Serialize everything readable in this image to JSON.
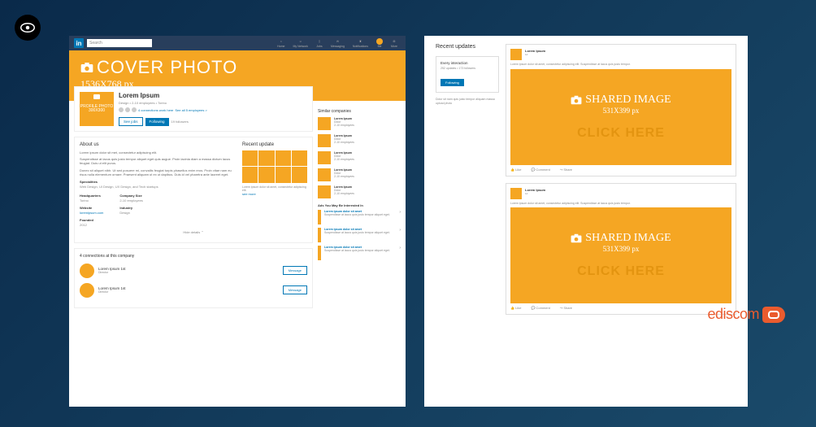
{
  "header": {
    "search_placeholder": "Search",
    "nav": [
      {
        "label": "Home"
      },
      {
        "label": "My Network"
      },
      {
        "label": "Jobs"
      },
      {
        "label": "Messaging"
      },
      {
        "label": "Notifications"
      },
      {
        "label": "Me"
      },
      {
        "label": "More"
      }
    ]
  },
  "cover": {
    "title": "COVER PHOTO",
    "size": "1536X768 px"
  },
  "profile": {
    "photo_label": "PROFILE PHOTO 300X300",
    "name": "Lorem Ipsum",
    "tagline": "Design • 2-10 employees • Torino",
    "connections_text": "4 connections work here",
    "see_all": "See all 5 employees >",
    "see_jobs": "See jobs",
    "following": "Following",
    "followers": "19 followers"
  },
  "about": {
    "heading": "About us",
    "p1": "Lorem ipsum dolor sit met, consectetur adipiscing elit.",
    "p2": "Suspendisse at lacus quis justo tempor aliquet eget quis augue. Proin lacinia diam a massa dictum lacus feugiat. Duis ut elit purus.",
    "p3": "Donec sit aliquet nibh. Ut sed posuere mi, convallis feugiat turpis phasellus enim eros. Proin vitae nam eu risus nulla elementum ornare. Praesent aliquam ut ex ut dapibus. Duis id vel pharetra ante laoreet eget.",
    "specialities_h": "Specialities",
    "specialities": "Web Design, UI Design, UX Design, and Tech startups",
    "hq_h": "Headquarters",
    "hq": "Torino",
    "size_h": "Company Size",
    "size": "2-10 employees",
    "web_h": "Website",
    "web": "loremipsum.com",
    "ind_h": "Industry",
    "ind": "Design",
    "founded_h": "Founded",
    "founded": "2012",
    "hide": "Hide details ⌃"
  },
  "recent_update": {
    "heading": "Recent update",
    "text": "Lorem ipsum dolor sit amet, consectetur adipiscing elit.",
    "see_more": "see more"
  },
  "connections": {
    "heading": "4 connections at this company",
    "items": [
      {
        "name": "Lorem Ipsum 1st",
        "role": "Director",
        "btn": "Message"
      },
      {
        "name": "Lorem Ipsum 1st",
        "role": "Director",
        "btn": "Message"
      }
    ]
  },
  "similar": {
    "heading": "Similar companies",
    "items": [
      {
        "name": "Lorem Ipsum",
        "meta1": "Dolor",
        "meta2": "2-10 employees"
      },
      {
        "name": "Lorem Ipsum",
        "meta1": "Dolor",
        "meta2": "2-10 employees"
      },
      {
        "name": "Lorem Ipsum",
        "meta1": "Dolor",
        "meta2": "2-10 employees"
      },
      {
        "name": "Lorem Ipsum",
        "meta1": "Dolor",
        "meta2": "2-10 employees"
      },
      {
        "name": "Lorem Ipsum",
        "meta1": "Dolor",
        "meta2": "2-10 employees"
      }
    ]
  },
  "ads": {
    "heading": "Ads You May Be Interested In",
    "items": [
      {
        "title": "Lorem ipsum dolor sit amet",
        "desc": "Suspendisse at lacus quis justo tempor aliquet eget."
      },
      {
        "title": "Lorem ipsum dolor sit amet",
        "desc": "Suspendisse at lacus quis justo tempor aliquet eget."
      },
      {
        "title": "Lorem ipsum dolor sit amet",
        "desc": "Suspendisse at lacus quis justo tempor aliquet eget."
      }
    ]
  },
  "right": {
    "heading": "Recent updates",
    "interaction": {
      "title": "Every interaction",
      "meta": "252 updates • 173 followers",
      "btn": "Following",
      "mini": "Dolor sit nam quis justo tempor aliquam massa upload photo"
    },
    "posts": [
      {
        "author": "Lorem Ipsum",
        "time": "1d",
        "desc": "Lorem ipsum dolor sit amet, consectetur adipiscing elit. Suspendisse at lacus quis justo tempor.",
        "img_title": "SHARED IMAGE",
        "img_size": "531X399 px",
        "click": "CLICK HERE",
        "like": "Like",
        "comment": "Comment",
        "share": "Share"
      },
      {
        "author": "Lorem Ipsum",
        "time": "1d",
        "desc": "Lorem ipsum dolor sit amet, consectetur adipiscing elit. Suspendisse at lacus quis justo tempor.",
        "img_title": "SHARED IMAGE",
        "img_size": "531X399 px",
        "click": "CLICK HERE",
        "like": "Like",
        "comment": "Comment",
        "share": "Share"
      }
    ]
  },
  "brand": {
    "name": "ediscom"
  }
}
